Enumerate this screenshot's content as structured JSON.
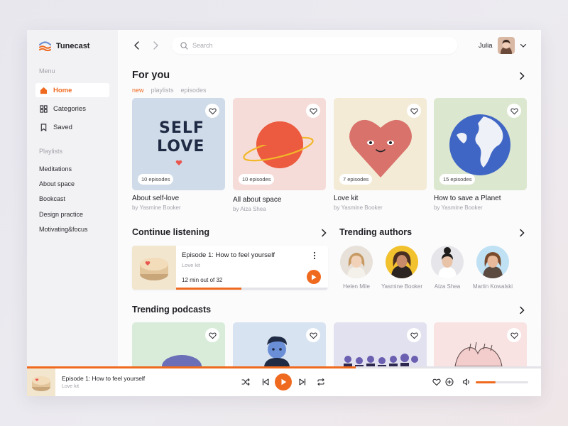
{
  "brand": {
    "name": "Tunecast",
    "color": "#ef6a1f"
  },
  "sidebar": {
    "menu_label": "Menu",
    "menu": [
      {
        "label": "Home",
        "icon": "home-icon",
        "active": true
      },
      {
        "label": "Categories",
        "icon": "grid-icon",
        "active": false
      },
      {
        "label": "Saved",
        "icon": "bookmark-icon",
        "active": false
      }
    ],
    "playlists_label": "Playlists",
    "playlists": [
      "Meditations",
      "About space",
      "Bookcast",
      "Design practice",
      "Motivating&focus"
    ]
  },
  "header": {
    "search_placeholder": "Search",
    "user_name": "Julia"
  },
  "for_you": {
    "title": "For you",
    "filters": [
      "new",
      "playlists",
      "episodes"
    ],
    "active_filter": "new",
    "cards": [
      {
        "title": "About self-love",
        "author": "by Yasmine Booker",
        "episodes": "10 episodes",
        "art_text_1": "SELF",
        "art_text_2": "LOVE",
        "bg": "#cfdbe8"
      },
      {
        "title": "All about space",
        "author": "by Aiza Shea",
        "episodes": "10 episodes",
        "bg": "#f6dcd8"
      },
      {
        "title": "Love kit",
        "author": "by Yasmine Booker",
        "episodes": "7 episodes",
        "bg": "#f4ebd6"
      },
      {
        "title": "How to save a Planet",
        "author": "by Yasmine Booker",
        "episodes": "15 episodes",
        "bg": "#dce7cf"
      }
    ]
  },
  "continue_listening": {
    "title": "Continue listening",
    "episode_title": "Episode 1: How to feel yourself",
    "podcast": "Love kit",
    "time_text": "12 min out of 32",
    "progress": 0.43
  },
  "trending_authors": {
    "title": "Trending authors",
    "authors": [
      {
        "name": "Helen Mile",
        "bg": "#e7e1da",
        "hair": "#c79a64",
        "skin": "#f1d2b8"
      },
      {
        "name": "Yasmine Booker",
        "bg": "#f2c12e",
        "hair": "#4a2e22",
        "skin": "#c98c6b"
      },
      {
        "name": "Aiza Shea",
        "bg": "#e6e6ea",
        "hair": "#1f1c1c",
        "skin": "#e9c3a7"
      },
      {
        "name": "Martin Kowalski",
        "bg": "#bfe1f3",
        "hair": "#7a4a2c",
        "skin": "#e8b99a"
      }
    ]
  },
  "trending_podcasts": {
    "title": "Trending podcasts",
    "cards": [
      {
        "bg": "#d8ecd9"
      },
      {
        "bg": "#d7e3f1"
      },
      {
        "bg": "#e2e1ef"
      },
      {
        "bg": "#f8e2e2"
      }
    ]
  },
  "player": {
    "title": "Episode 1: How to feel yourself",
    "podcast": "Love kit",
    "progress": 0.64,
    "volume": 0.38
  }
}
